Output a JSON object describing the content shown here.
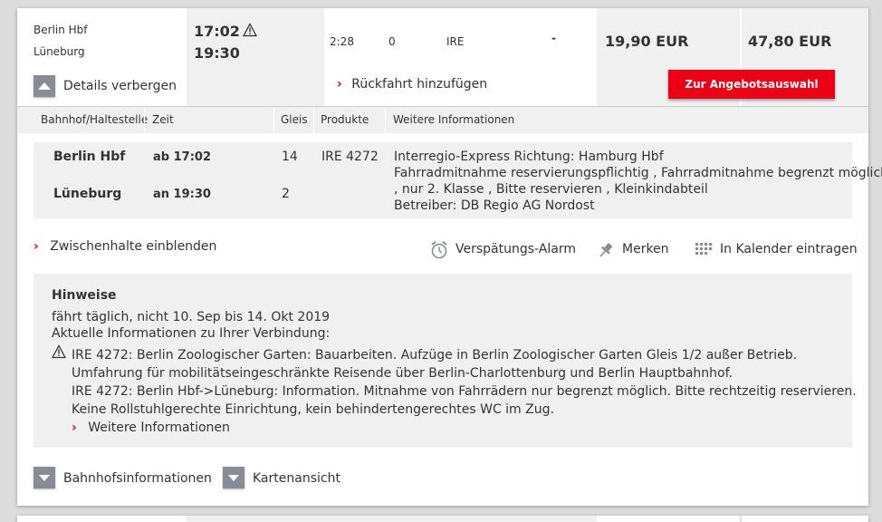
{
  "connection": {
    "from_station": "Berlin Hbf",
    "to_station": "Lüneburg",
    "dep_time": "17:02",
    "arr_time": "19:30",
    "duration": "2:28",
    "changes": "0",
    "products": "IRE",
    "dash": "-",
    "price_1": "19,90 EUR",
    "price_2": "47,80 EUR",
    "offer_button": "Zur Angebotsauswahl",
    "details_toggle": "Details verbergen",
    "return_trip": "Rückfahrt hinzufügen"
  },
  "table_header": {
    "station": "Bahnhof/Haltestelle",
    "time": "Zeit",
    "track": "Gleis",
    "products": "Produkte",
    "info": "Weitere Informationen"
  },
  "journey": {
    "dep_station": "Berlin Hbf",
    "dep_time": "ab 17:02",
    "dep_track": "14",
    "arr_station": "Lüneburg",
    "arr_time": "an 19:30",
    "arr_track": "2",
    "train": "IRE 4272",
    "info_lines": [
      "Interregio-Express Richtung: Hamburg Hbf",
      "Fahrradmitnahme reservierungspflichtig , Fahrradmitnahme begrenzt möglich",
      ", nur 2. Klasse , Bitte reservieren , Kleinkindabteil",
      "Betreiber: DB Regio AG Nordost"
    ]
  },
  "actions": {
    "intermediate_stops": "Zwischenhalte einblenden",
    "delay_alarm": "Verspätungs-Alarm",
    "remember": "Merken",
    "calendar": "In Kalender eintragen"
  },
  "notes": {
    "title": "Hinweise",
    "schedule": "fährt täglich, nicht 10. Sep bis 14. Okt 2019",
    "current_info": "Aktuelle Informationen zu Ihrer Verbindung:",
    "messages": [
      "IRE 4272: Berlin Zoologischer Garten: Bauarbeiten. Aufzüge in Berlin Zoologischer Garten Gleis 1/2 außer Betrieb.",
      "Umfahrung für mobilitätseingeschränkte Reisende über Berlin-Charlottenburg und Berlin Hauptbahnhof.",
      "IRE 4272: Berlin Hbf->Lüneburg: Information. Mitnahme von Fahrrädern nur begrenzt möglich. Bitte rechtzeitig reservieren.",
      "Keine Rollstuhlgerechte Einrichtung, kein behindertengerechtes WC im Zug."
    ],
    "more_info": "Weitere Informationen"
  },
  "footer": {
    "station_info": "Bahnhofsinformationen",
    "map_view": "Kartenansicht"
  },
  "colors": {
    "accent_red": "#ec0016",
    "panel_grey": "#f0f0f0",
    "toggle_grey": "#878c96"
  },
  "icons": [
    "warning-icon",
    "chevron-up-icon",
    "chevron-right-icon",
    "alarm-clock-icon",
    "pin-icon",
    "calendar-icon",
    "chevron-down-icon"
  ]
}
